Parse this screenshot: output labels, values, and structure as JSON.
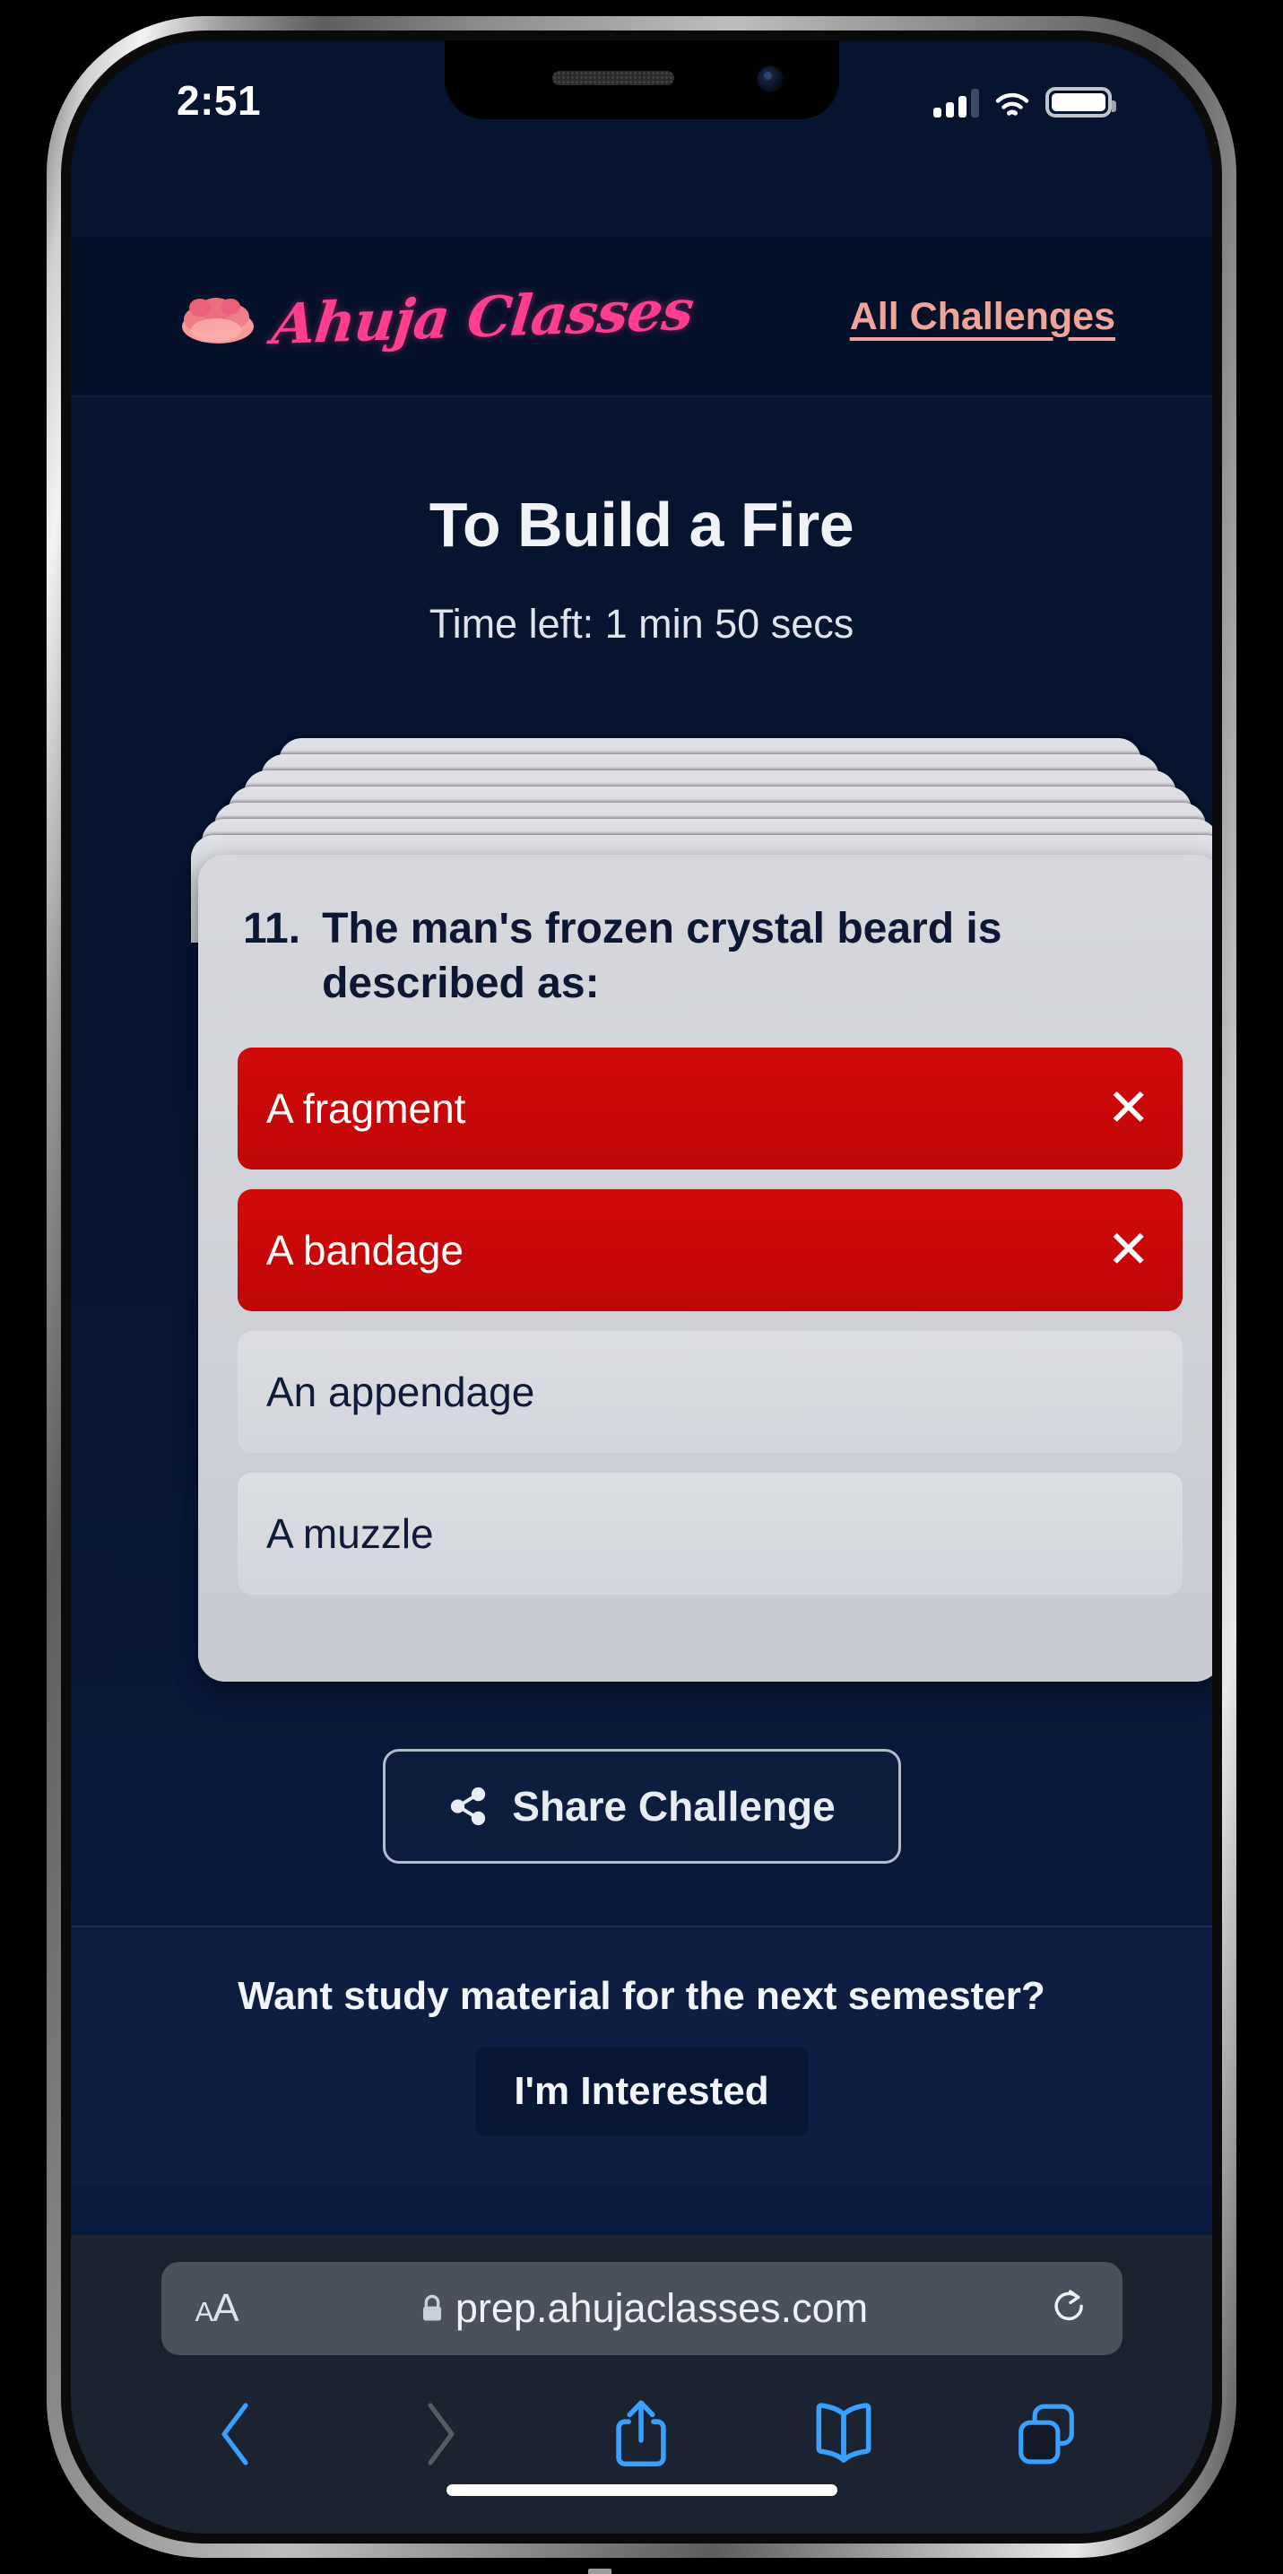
{
  "status_bar": {
    "time": "2:51",
    "signal_icon": "cellular-bars-icon",
    "signal_bars_filled": 3,
    "signal_bars_total": 4,
    "wifi_icon": "wifi-icon",
    "battery_icon": "battery-full-icon"
  },
  "site_header": {
    "logo_icon": "rose-logo-icon",
    "brand_name": "Ahuja Classes",
    "brand_color": "#ff3e8f",
    "all_challenges_label": "All Challenges",
    "all_challenges_color": "#f0a499"
  },
  "quiz": {
    "title": "To Build a Fire",
    "timer_label": "Time left: 1 min 50 secs",
    "question_number": "11.",
    "question_text": "The man's frozen crystal beard is described as:",
    "stack_layers": 7,
    "options": [
      {
        "label": "A fragment",
        "state": "wrong",
        "mark": "✕"
      },
      {
        "label": "A bandage",
        "state": "wrong",
        "mark": "✕"
      },
      {
        "label": "An appendage",
        "state": "neutral",
        "mark": ""
      },
      {
        "label": "A muzzle",
        "state": "neutral",
        "mark": ""
      }
    ],
    "wrong_color": "#c90b0b",
    "neutral_color": "#d6d9de"
  },
  "share": {
    "icon": "share-nodes-icon",
    "label": "Share Challenge"
  },
  "cta": {
    "prompt": "Want study material for the next semester?",
    "button_label": "I'm Interested"
  },
  "browser": {
    "text_size_small": "A",
    "text_size_large": "A",
    "lock_icon": "lock-icon",
    "url": "prep.ahujaclasses.com",
    "reload_icon": "reload-icon",
    "toolbar": [
      {
        "name": "back-icon",
        "enabled": true
      },
      {
        "name": "forward-icon",
        "enabled": false
      },
      {
        "name": "share-icon",
        "enabled": true
      },
      {
        "name": "bookmarks-icon",
        "enabled": true
      },
      {
        "name": "tabs-icon",
        "enabled": true
      }
    ],
    "accent_color": "#3aa0ff",
    "disabled_color": "#555c66"
  }
}
